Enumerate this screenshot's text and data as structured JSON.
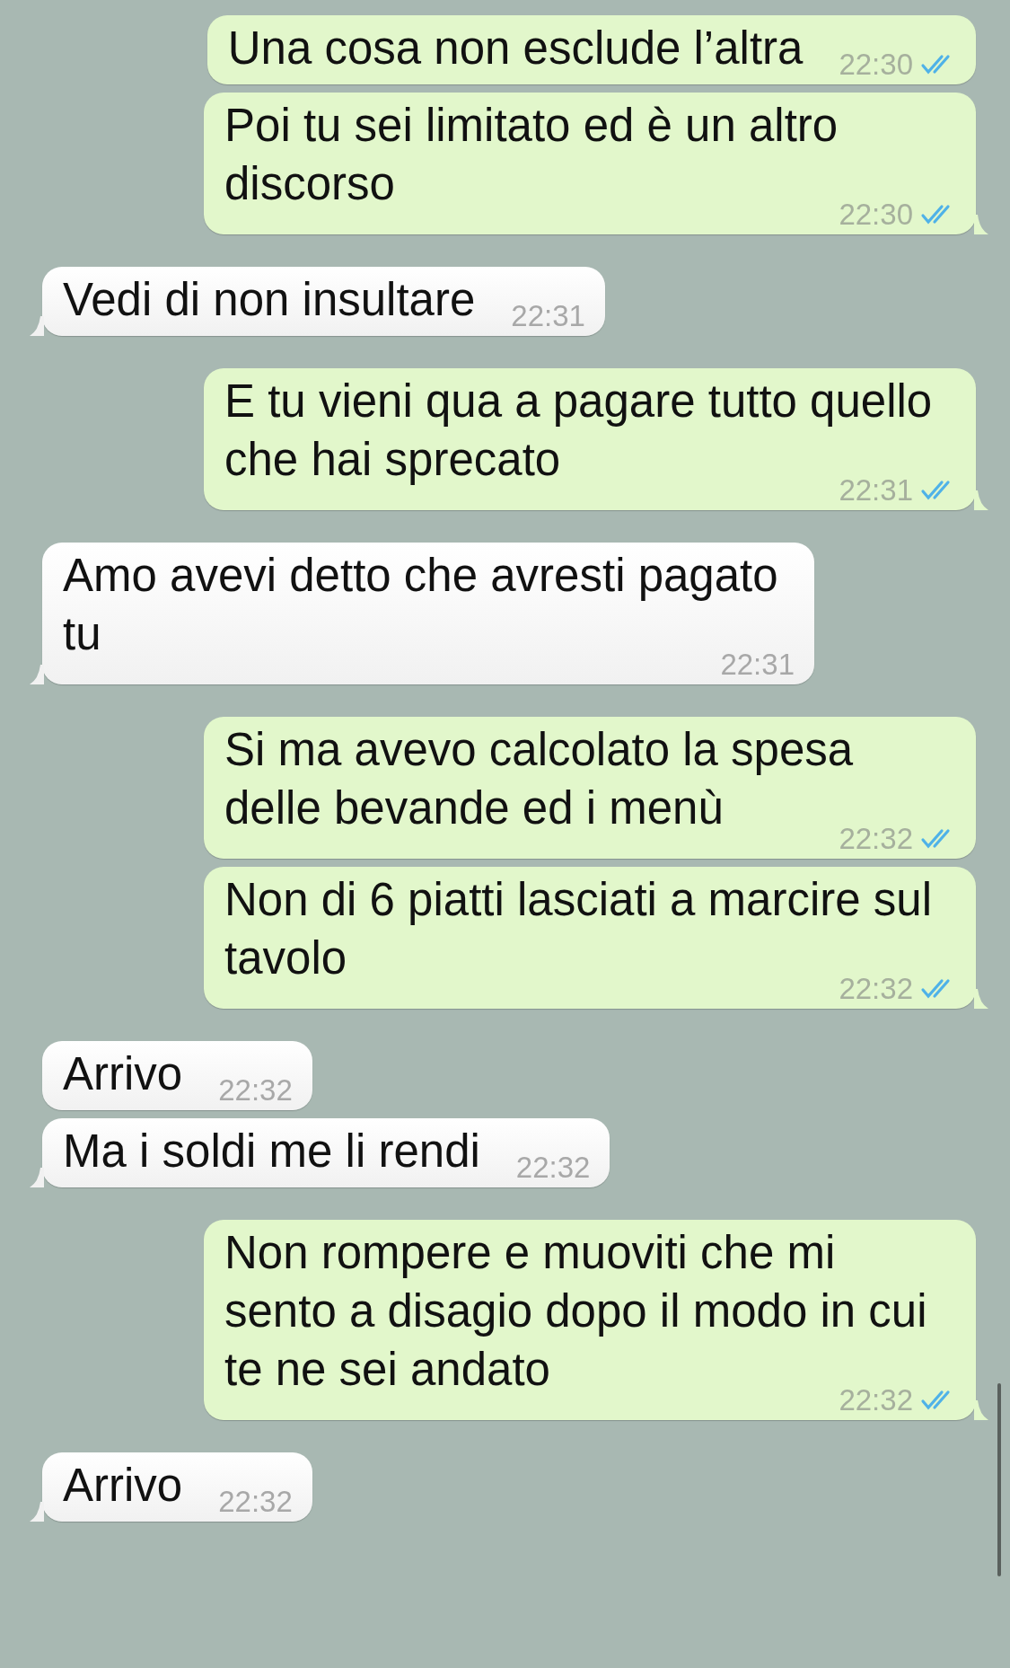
{
  "messages": [
    {
      "kind": "outgoing",
      "text": "Una cosa non esclude l’altra",
      "time": "22:30",
      "read": true,
      "tail": false
    },
    {
      "kind": "outgoing",
      "text": "Poi tu sei limitato ed è un altro discorso",
      "time": "22:30",
      "read": true,
      "tail": true
    },
    {
      "kind": "incoming",
      "text": "Vedi di non insultare",
      "time": "22:31",
      "tail": true
    },
    {
      "kind": "outgoing",
      "text": "E tu vieni qua a pagare tutto quello che hai sprecato",
      "time": "22:31",
      "read": true,
      "tail": true
    },
    {
      "kind": "incoming",
      "text": "Amo avevi detto che avresti pagato tu",
      "time": "22:31",
      "tail": true
    },
    {
      "kind": "outgoing",
      "text": "Si ma avevo calcolato la spesa delle bevande ed i menù",
      "time": "22:32",
      "read": true,
      "tail": false
    },
    {
      "kind": "outgoing",
      "text": "Non di 6 piatti lasciati a marcire sul tavolo",
      "time": "22:32",
      "read": true,
      "tail": true
    },
    {
      "kind": "incoming",
      "text": "Arrivo",
      "time": "22:32",
      "tail": false
    },
    {
      "kind": "incoming",
      "text": "Ma i soldi me li rendi",
      "time": "22:32",
      "tail": true
    },
    {
      "kind": "outgoing",
      "text": "Non rompere e muoviti che mi sento a disagio dopo il modo in cui te ne sei andato",
      "time": "22:32",
      "read": true,
      "tail": true
    },
    {
      "kind": "incoming",
      "text": "Arrivo",
      "time": "22:32",
      "tail": true
    }
  ]
}
